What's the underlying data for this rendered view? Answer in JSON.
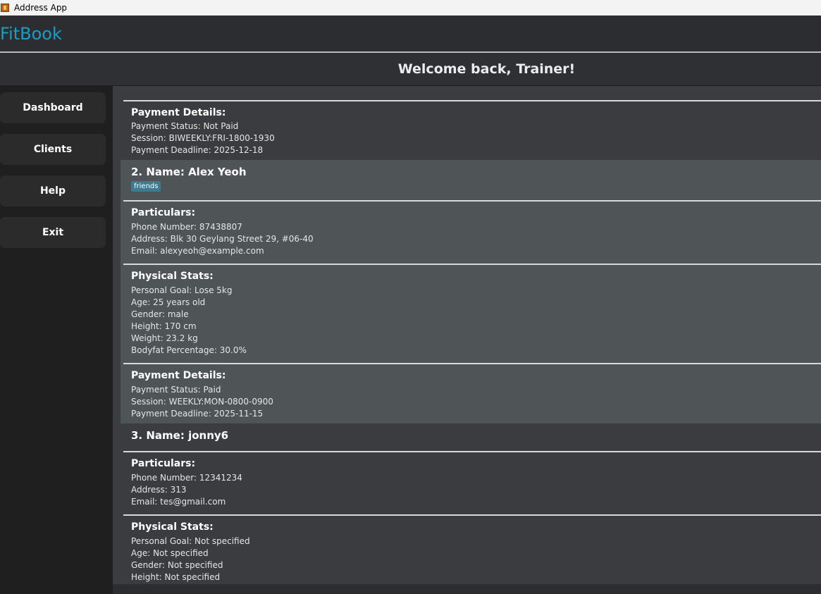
{
  "window": {
    "title": "Address App"
  },
  "app": {
    "brand": "FitBook",
    "welcome": "Welcome back, Trainer!"
  },
  "sidebar": {
    "items": [
      {
        "label": "Dashboard"
      },
      {
        "label": "Clients"
      },
      {
        "label": "Help"
      },
      {
        "label": "Exit"
      }
    ]
  },
  "clients": [
    {
      "payment": {
        "title": "Payment Details:",
        "status": "Payment Status: Not Paid",
        "session": "Session: BIWEEKLY:FRI-1800-1930",
        "deadline": "Payment Deadline: 2025-12-18"
      }
    },
    {
      "index": "2.",
      "name": "Name: Alex Yeoh",
      "tags": [
        "friends"
      ],
      "particulars": {
        "title": "Particulars:",
        "phone": "Phone Number: 87438807",
        "address": "Address: Blk 30 Geylang Street 29, #06-40",
        "email": "Email: alexyeoh@example.com"
      },
      "stats": {
        "title": "Physical Stats:",
        "goal": "Personal Goal: Lose 5kg",
        "age": "Age: 25 years old",
        "gender": "Gender: male",
        "height": "Height: 170 cm",
        "weight": "Weight: 23.2 kg",
        "bodyfat": "Bodyfat Percentage: 30.0%"
      },
      "payment": {
        "title": "Payment Details:",
        "status": "Payment Status: Paid",
        "session": "Session: WEEKLY:MON-0800-0900",
        "deadline": "Payment Deadline: 2025-11-15"
      }
    },
    {
      "index": "3.",
      "name": "Name: jonny6",
      "particulars": {
        "title": "Particulars:",
        "phone": "Phone Number: 12341234",
        "address": "Address: 313",
        "email": "Email: tes@gmail.com"
      },
      "stats": {
        "title": "Physical Stats:",
        "goal": "Personal Goal: Not specified",
        "age": "Age: Not specified",
        "gender": "Gender: Not specified",
        "height": "Height: Not specified"
      }
    }
  ],
  "colors": {
    "brand": "#1f9bc4",
    "tag": "#3e7b91",
    "selected_card": "#4f5456",
    "card": "#3a3c3f"
  },
  "icons": {
    "app": "address-app-icon"
  }
}
